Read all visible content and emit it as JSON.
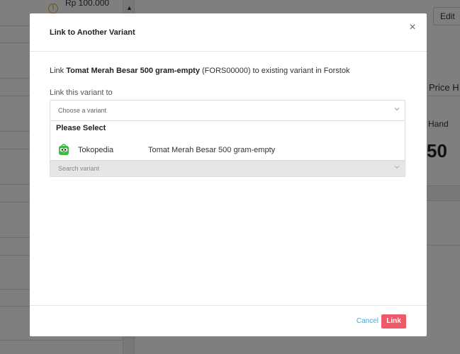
{
  "background": {
    "price": "Rp 100.000",
    "warning_glyph": "!",
    "edit_label": "Edit",
    "price_header": "Price H",
    "hand_label": "Hand",
    "big_value": "50"
  },
  "modal": {
    "title": "Link to Another Variant",
    "close_glyph": "×",
    "description": {
      "prefix": "Link ",
      "variant_name": "Tomat Merah Besar 500 gram-empty",
      "suffix": " (FORS00000) to existing variant in Forstok"
    },
    "field_label": "Link this variant to",
    "select_placeholder": "Choose a variant",
    "dropdown": {
      "header": "Please Select",
      "items": [
        {
          "store": "Tokopedia",
          "variant": "Tomat Merah Besar 500 gram-empty",
          "icon": "tokopedia-logo-icon"
        }
      ]
    },
    "search_placeholder": "Search variant",
    "footer": {
      "cancel_label": "Cancel",
      "link_label": "Link"
    }
  },
  "colors": {
    "accent_link": "#3fa9d6",
    "primary_button": "#ef5a6b",
    "tokopedia_green": "#42b549"
  }
}
